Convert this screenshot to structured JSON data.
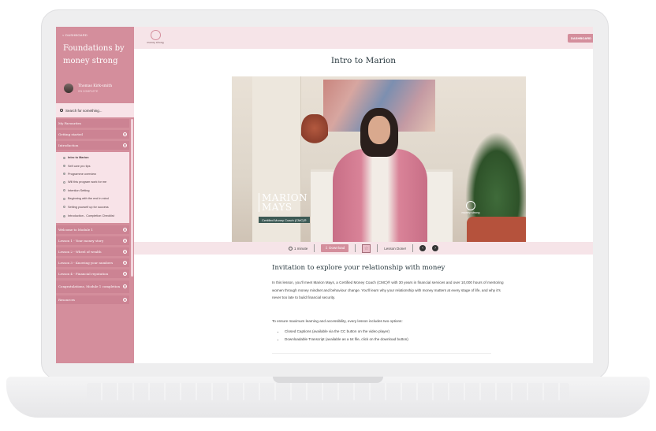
{
  "sidebar": {
    "back_label": "< DASHBOARD",
    "course_title": "Foundations by money strong",
    "user_name": "Thomas Kirk-smith",
    "user_progress": "0% COMPLETE",
    "search_placeholder": "Search for something...",
    "favourites": "My Favourites",
    "items_before": [
      {
        "label": "Getting started"
      },
      {
        "label": "Introduction"
      }
    ],
    "introduction_lessons": [
      {
        "label": "Intro to Marion",
        "active": true
      },
      {
        "label": "Self care pro tips"
      },
      {
        "label": "Programme overview"
      },
      {
        "label": "Will this program work for me"
      },
      {
        "label": "Intention Setting"
      },
      {
        "label": "Beginning with the end in mind"
      },
      {
        "label": "Setting yourself up for success"
      },
      {
        "label": "Introduction - Completion Checklist"
      }
    ],
    "items_after": [
      {
        "label": "Welcome to Module 1"
      },
      {
        "label": "Lesson 1 - Your money story"
      },
      {
        "label": "Lesson 2 - Wheel of wealth"
      },
      {
        "label": "Lesson 3 - Knowing your numbers"
      },
      {
        "label": "Lesson 4 - Financial reputation"
      },
      {
        "label": "Congratulations, Module 1 completion"
      },
      {
        "label": "Resources"
      }
    ]
  },
  "header": {
    "logo_text": "money strong",
    "dashboard_button": "DASHBOARD"
  },
  "lesson": {
    "title": "Intro to Marion",
    "video": {
      "name_line1": "MARION",
      "name_line2": "MAYS",
      "caption": "Certified Money Coach (CMC)®",
      "logo_text": "money strong"
    },
    "controls": {
      "duration": "1 minute",
      "download": "Download",
      "lesson_done": "Lesson Done!"
    },
    "heading": "Invitation to explore your relationship with money",
    "paragraph": "In this lesson, you'll meet Marion Mays, a Certified Money Coach (CMC)® with 30 years in financial services and over 10,000 hours of mentoring women through money mindset and behaviour change. You'll learn why your relationship with money matters at every stage of life, and why it's never too late to build financial security.",
    "accessibility_intro": "To ensure maximum learning and accessibility, every lesson includes two options:",
    "options": [
      "Closed Captions (available via the CC button on the video player)",
      "Downloadable Transcript (available as a txt file, click on the download button)"
    ]
  },
  "colors": {
    "accent": "#d48e9c",
    "light_pink": "#f6e4e8"
  }
}
